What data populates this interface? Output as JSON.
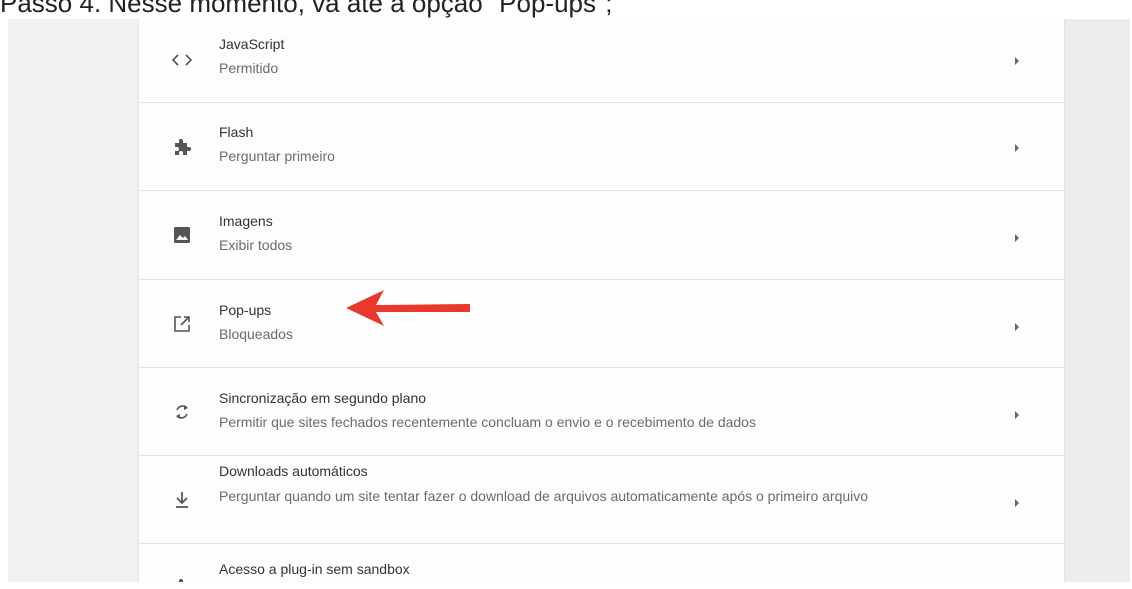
{
  "caption": "Passo 4. Nesse momento, vá até a opção \"Pop-ups\";",
  "settings": [
    {
      "title": "JavaScript",
      "subtitle": "Permitido",
      "icon": "code-icon"
    },
    {
      "title": "Flash",
      "subtitle": "Perguntar primeiro",
      "icon": "puzzle-icon"
    },
    {
      "title": "Imagens",
      "subtitle": "Exibir todos",
      "icon": "image-icon"
    },
    {
      "title": "Pop-ups",
      "subtitle": "Bloqueados",
      "icon": "open-in-new-icon"
    },
    {
      "title": "Sincronização em segundo plano",
      "subtitle": "Permitir que sites fechados recentemente concluam o envio e o recebimento de dados",
      "icon": "sync-icon"
    },
    {
      "title": "Downloads automáticos",
      "subtitle": "Perguntar quando um site tentar fazer o download de arquivos automaticamente após o primeiro arquivo",
      "icon": "download-icon"
    },
    {
      "title": "Acesso a plug-in sem sandbox",
      "subtitle": "",
      "icon": "puzzle-icon"
    }
  ],
  "colors": {
    "annotation_arrow": "#e8392c",
    "icon": "#555555",
    "card": "#fdfdfd",
    "background": "#efefef"
  }
}
